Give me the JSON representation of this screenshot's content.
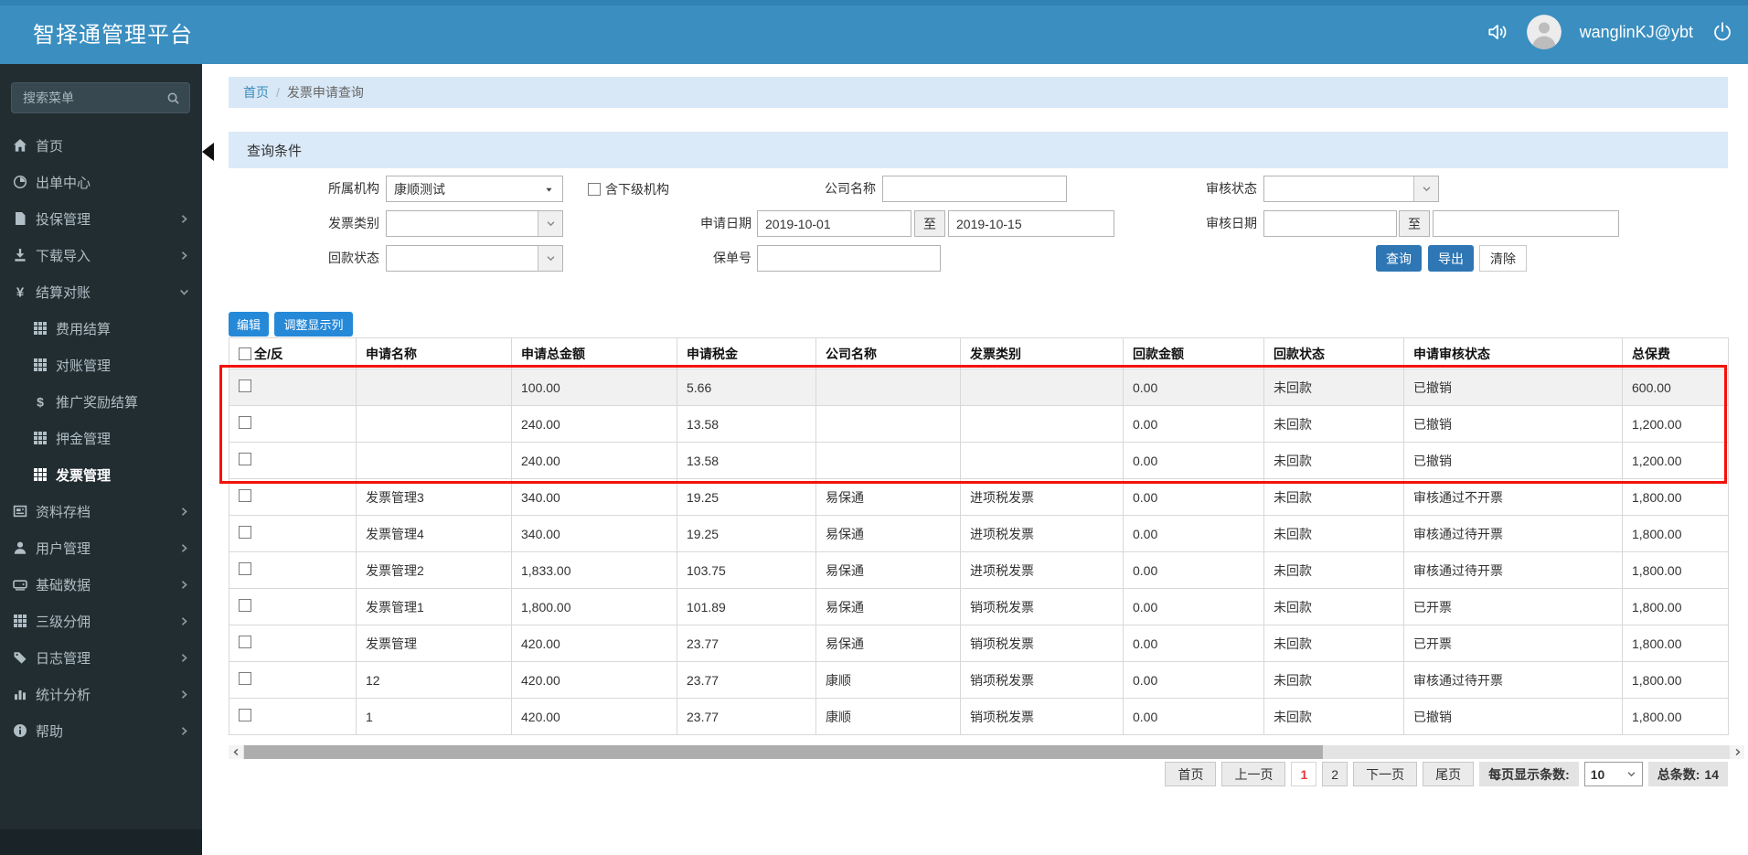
{
  "header": {
    "title": "智择通管理平台",
    "username": "wanglinKJ@ybt"
  },
  "sidebar": {
    "search_placeholder": "搜索菜单",
    "items": [
      {
        "key": "home",
        "label": "首页",
        "icon": "home-icon"
      },
      {
        "key": "order-center",
        "label": "出单中心",
        "icon": "clock-icon"
      },
      {
        "key": "policy-mgmt",
        "label": "投保管理",
        "icon": "file-icon",
        "chevron": "right"
      },
      {
        "key": "download-import",
        "label": "下载导入",
        "icon": "download-icon",
        "chevron": "right"
      },
      {
        "key": "settlement",
        "label": "结算对账",
        "icon": "yen-icon",
        "chevron": "down",
        "expanded": true
      },
      {
        "key": "fee-settlement",
        "label": "费用结算",
        "icon": "grid-icon",
        "sub": true
      },
      {
        "key": "reconciliation",
        "label": "对账管理",
        "icon": "grid-icon",
        "sub": true
      },
      {
        "key": "promo-reward",
        "label": "推广奖励结算",
        "icon": "dollar-icon",
        "sub": true
      },
      {
        "key": "deposit-mgmt",
        "label": "押金管理",
        "icon": "grid-icon",
        "sub": true
      },
      {
        "key": "invoice-mgmt",
        "label": "发票管理",
        "icon": "grid-icon",
        "sub": true,
        "active": true
      },
      {
        "key": "archive",
        "label": "资料存档",
        "icon": "archive-icon",
        "chevron": "right"
      },
      {
        "key": "user-mgmt",
        "label": "用户管理",
        "icon": "user-icon",
        "chevron": "right"
      },
      {
        "key": "base-data",
        "label": "基础数据",
        "icon": "hdd-icon",
        "chevron": "right"
      },
      {
        "key": "three-level-commission",
        "label": "三级分佣",
        "icon": "grid-icon",
        "chevron": "right"
      },
      {
        "key": "log-mgmt",
        "label": "日志管理",
        "icon": "tags-icon",
        "chevron": "right"
      },
      {
        "key": "stats-analysis",
        "label": "统计分析",
        "icon": "chart-icon",
        "chevron": "right"
      },
      {
        "key": "help",
        "label": "帮助",
        "icon": "info-icon",
        "chevron": "right"
      }
    ]
  },
  "breadcrumb": {
    "home": "首页",
    "sep": "/",
    "current": "发票申请查询"
  },
  "filter": {
    "title": "查询条件",
    "range_sep": "至",
    "org": {
      "label": "所属机构",
      "value": "康顺测试"
    },
    "include_sub": {
      "label": "含下级机构",
      "checked": false
    },
    "company": {
      "label": "公司名称",
      "value": ""
    },
    "audit_status": {
      "label": "审核状态",
      "value": ""
    },
    "invoice_type": {
      "label": "发票类别",
      "value": ""
    },
    "apply_date": {
      "label": "申请日期",
      "from": "2019-10-01",
      "to": "2019-10-15"
    },
    "audit_date": {
      "label": "审核日期",
      "from": "",
      "to": ""
    },
    "refund_status": {
      "label": "回款状态",
      "value": ""
    },
    "policy_no": {
      "label": "保单号",
      "value": ""
    },
    "buttons": {
      "query": "查询",
      "export": "导出",
      "clear": "清除"
    }
  },
  "toolbar": {
    "edit": "编辑",
    "adjust_columns": "调整显示列"
  },
  "table": {
    "columns": [
      "全/反",
      "申请名称",
      "申请总金额",
      "申请税金",
      "公司名称",
      "发票类别",
      "回款金额",
      "回款状态",
      "申请审核状态",
      "总保费"
    ],
    "rows": [
      {
        "name": "",
        "total": "100.00",
        "tax": "5.66",
        "company": "",
        "type": "",
        "refund_amount": "0.00",
        "refund_status": "未回款",
        "audit_status": "已撤销",
        "premium": "600.00"
      },
      {
        "name": "",
        "total": "240.00",
        "tax": "13.58",
        "company": "",
        "type": "",
        "refund_amount": "0.00",
        "refund_status": "未回款",
        "audit_status": "已撤销",
        "premium": "1,200.00"
      },
      {
        "name": "",
        "total": "240.00",
        "tax": "13.58",
        "company": "",
        "type": "",
        "refund_amount": "0.00",
        "refund_status": "未回款",
        "audit_status": "已撤销",
        "premium": "1,200.00"
      },
      {
        "name": "发票管理3",
        "total": "340.00",
        "tax": "19.25",
        "company": "易保通",
        "type": "进项税发票",
        "refund_amount": "0.00",
        "refund_status": "未回款",
        "audit_status": "审核通过不开票",
        "premium": "1,800.00"
      },
      {
        "name": "发票管理4",
        "total": "340.00",
        "tax": "19.25",
        "company": "易保通",
        "type": "进项税发票",
        "refund_amount": "0.00",
        "refund_status": "未回款",
        "audit_status": "审核通过待开票",
        "premium": "1,800.00"
      },
      {
        "name": "发票管理2",
        "total": "1,833.00",
        "tax": "103.75",
        "company": "易保通",
        "type": "进项税发票",
        "refund_amount": "0.00",
        "refund_status": "未回款",
        "audit_status": "审核通过待开票",
        "premium": "1,800.00"
      },
      {
        "name": "发票管理1",
        "total": "1,800.00",
        "tax": "101.89",
        "company": "易保通",
        "type": "销项税发票",
        "refund_amount": "0.00",
        "refund_status": "未回款",
        "audit_status": "已开票",
        "premium": "1,800.00"
      },
      {
        "name": "发票管理",
        "total": "420.00",
        "tax": "23.77",
        "company": "易保通",
        "type": "销项税发票",
        "refund_amount": "0.00",
        "refund_status": "未回款",
        "audit_status": "已开票",
        "premium": "1,800.00"
      },
      {
        "name": "12",
        "total": "420.00",
        "tax": "23.77",
        "company": "康顺",
        "type": "销项税发票",
        "refund_amount": "0.00",
        "refund_status": "未回款",
        "audit_status": "审核通过待开票",
        "premium": "1,800.00"
      },
      {
        "name": "1",
        "total": "420.00",
        "tax": "23.77",
        "company": "康顺",
        "type": "销项税发票",
        "refund_amount": "0.00",
        "refund_status": "未回款",
        "audit_status": "已撤销",
        "premium": "1,800.00"
      }
    ],
    "highlighted_row_count": 3
  },
  "pagination": {
    "first": "首页",
    "prev": "上一页",
    "pages": [
      "1",
      "2"
    ],
    "current": "1",
    "next": "下一页",
    "last": "尾页",
    "per_page_label": "每页显示条数:",
    "per_page": "10",
    "total_label": "总条数:",
    "total": "14"
  }
}
